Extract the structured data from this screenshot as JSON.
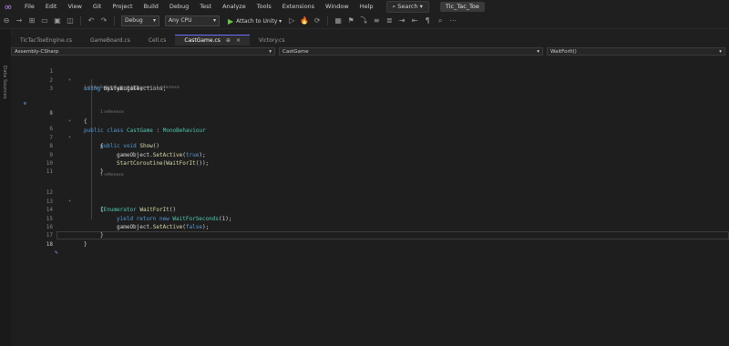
{
  "menubar": {
    "items": [
      "File",
      "Edit",
      "View",
      "Git",
      "Project",
      "Build",
      "Debug",
      "Test",
      "Analyze",
      "Tools",
      "Extensions",
      "Window",
      "Help"
    ],
    "search_label": "Search",
    "solution_name": "Tic_Tac_Toe"
  },
  "toolbar": {
    "config": "Debug",
    "platform": "Any CPU",
    "attach_label": "Attach to Unity"
  },
  "left_rail": {
    "label": "Data Sources"
  },
  "tabs": [
    {
      "label": "TicTacToeEngine.cs",
      "active": false
    },
    {
      "label": "GameBoard.cs",
      "active": false
    },
    {
      "label": "Cell.cs",
      "active": false
    },
    {
      "label": "CastGame.cs",
      "active": true
    },
    {
      "label": "Victory.cs",
      "active": false
    }
  ],
  "navbar": {
    "project": "Assembly-CSharp",
    "class": "CastGame",
    "member": "WaitForIt()"
  },
  "codelens": {
    "line4": "1 Unity Script (1 asset reference) | 1 reference",
    "line6": "1 reference",
    "line12": "1 reference"
  },
  "code": {
    "l1": [
      "using",
      " System.Collections;"
    ],
    "l2": [
      "using",
      " UnityEngine;"
    ],
    "l4": [
      "public class",
      " CastGame",
      " : ",
      "MonoBehaviour"
    ],
    "l5": "{",
    "l6": [
      "public void",
      " Show",
      "()"
    ],
    "l7": "{",
    "l8": [
      "gameObject.",
      "SetActive",
      "(",
      "true",
      ");"
    ],
    "l9": [
      "StartCoroutine",
      "(",
      "WaitForIt",
      "());"
    ],
    "l10": "}",
    "l12": [
      "IEnumerator",
      " WaitForIt",
      "()"
    ],
    "l13": "{",
    "l14": [
      "yield return new",
      " WaitForSeconds",
      "(1);"
    ],
    "l15": [
      "gameObject.",
      "SetActive",
      "(",
      "false",
      ");"
    ],
    "l16": "}",
    "l17": "}"
  },
  "line_numbers": [
    "1",
    "2",
    "3",
    "4",
    "5",
    "6",
    "7",
    "8",
    "9",
    "10",
    "11",
    "12",
    "13",
    "14",
    "15",
    "16",
    "17",
    "18"
  ],
  "colors": {
    "keyword": "#569cd6",
    "type": "#4ec9b0",
    "method": "#dcdcaa",
    "text": "#d4d4d4",
    "accent": "#6c6cff"
  }
}
